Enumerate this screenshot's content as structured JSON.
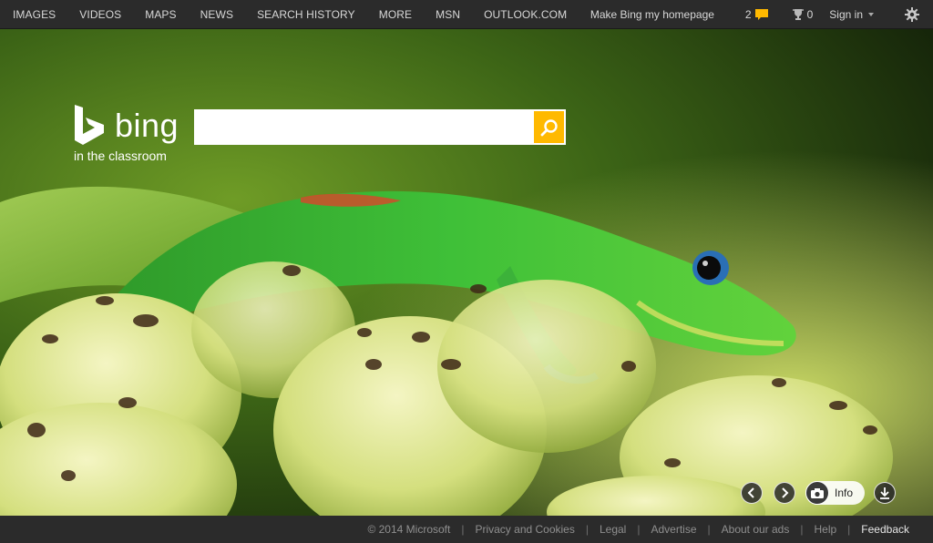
{
  "nav": {
    "items": [
      "IMAGES",
      "VIDEOS",
      "MAPS",
      "NEWS",
      "SEARCH HISTORY",
      "MORE",
      "MSN",
      "OUTLOOK.COM"
    ]
  },
  "header": {
    "homepage_label": "Make Bing my homepage",
    "notifications_count": "2",
    "rewards_count": "0",
    "signin_label": "Sign in"
  },
  "logo": {
    "wordmark": "bing",
    "subtitle": "in the classroom"
  },
  "search": {
    "value": "",
    "placeholder": ""
  },
  "controls": {
    "info_label": "Info"
  },
  "footer": {
    "copyright": "© 2014 Microsoft",
    "links": [
      "Privacy and Cookies",
      "Legal",
      "Advertise",
      "About our ads",
      "Help",
      "Feedback"
    ]
  },
  "colors": {
    "topbar_bg": "#2b2b2b",
    "search_button": "#ffb900",
    "footer_bg": "#2b2b2b"
  }
}
